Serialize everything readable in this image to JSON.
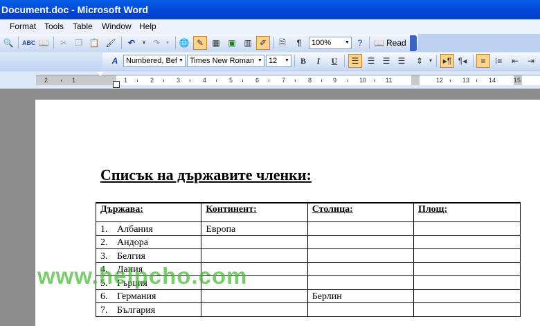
{
  "window": {
    "title": "Document.doc - Microsoft Word"
  },
  "menu": [
    "Format",
    "Tools",
    "Table",
    "Window",
    "Help"
  ],
  "toolbar_standard": {
    "zoom": "100%",
    "read_label": "Read"
  },
  "toolbar_formatting": {
    "style": "Numbered, Bef",
    "font": "Times New Roman",
    "size": "12",
    "bold": "B",
    "italic": "I",
    "underline": "U"
  },
  "ruler": {
    "labels": [
      "2",
      "1",
      "1",
      "2",
      "3",
      "4",
      "5",
      "6",
      "7",
      "8",
      "9",
      "10",
      "11",
      "12",
      "13",
      "14",
      "15"
    ]
  },
  "document": {
    "heading": "Списък на държавите членки:",
    "table": {
      "headers": [
        "Държава:",
        "Континент:",
        "Столица:",
        "Площ:"
      ],
      "rows": [
        {
          "num": "1.",
          "country": "Албания",
          "continent": "Европа",
          "capital": "",
          "area": ""
        },
        {
          "num": "2.",
          "country": "Андора",
          "continent": "",
          "capital": "",
          "area": ""
        },
        {
          "num": "3.",
          "country": "Белгия",
          "continent": "",
          "capital": "",
          "area": ""
        },
        {
          "num": "4.",
          "country": "Дания",
          "continent": "",
          "capital": "",
          "area": ""
        },
        {
          "num": "5.",
          "country": "Гърция",
          "continent": "",
          "capital": "",
          "area": ""
        },
        {
          "num": "6.",
          "country": "Германия",
          "continent": "",
          "capital": "Берлин",
          "area": ""
        },
        {
          "num": "7.",
          "country": "България",
          "continent": "",
          "capital": "",
          "area": ""
        }
      ]
    }
  },
  "watermark": "www.helpcho.com"
}
